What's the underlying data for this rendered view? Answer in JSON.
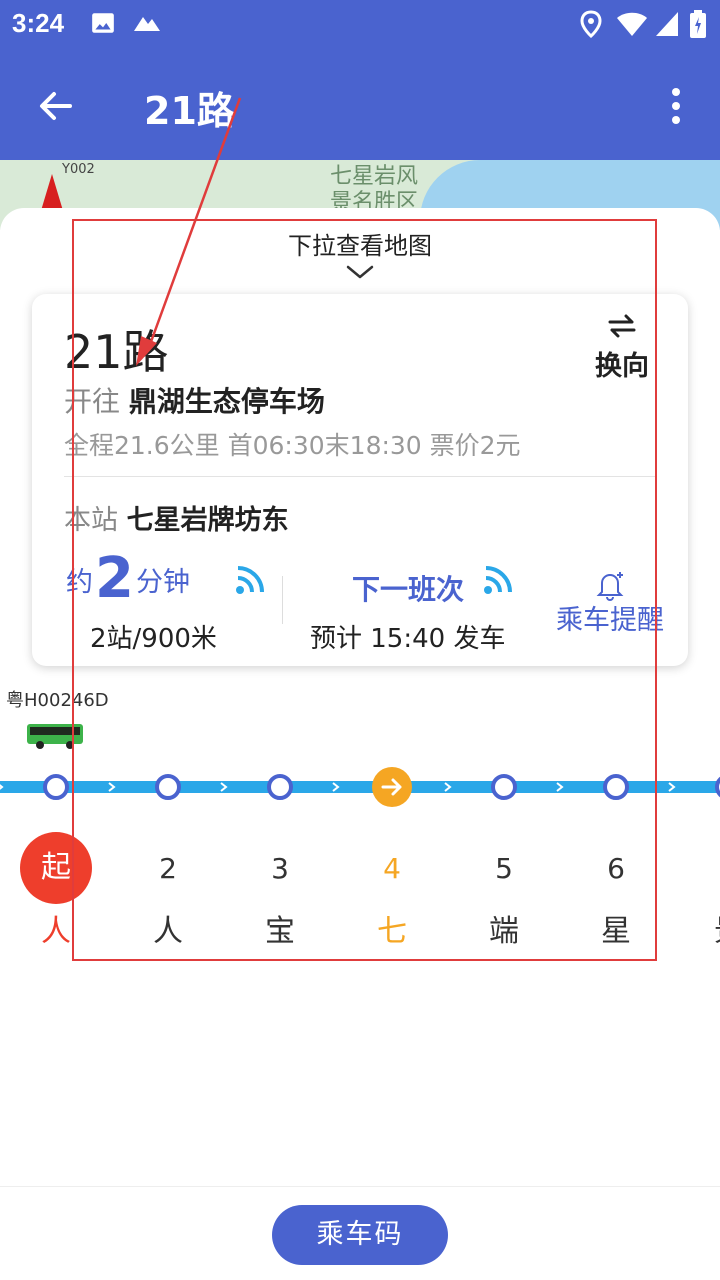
{
  "status_bar": {
    "time": "3:24"
  },
  "app_bar": {
    "title": "21路"
  },
  "map": {
    "road_label": "Y002",
    "scenic_line1": "七星岩风",
    "scenic_line2": "景名胜区"
  },
  "sheet": {
    "pull_hint": "下拉查看地图"
  },
  "route_card": {
    "route_name": "21路",
    "direction_prefix": "开往",
    "destination": "鼎湖生态停车场",
    "meta": "全程21.6公里  首06:30末18:30  票价2元",
    "swap_label": "换向",
    "current_station_prefix": "本站",
    "current_station": "七星岩牌坊东",
    "eta_prefix": "约",
    "eta_value": "2",
    "eta_unit": "分钟",
    "eta_detail": "2站/900米",
    "next_label": "下一班次",
    "next_detail": "预计 15:40 发车",
    "remind_label": "乘车提醒"
  },
  "bus": {
    "plate": "粤H00246D"
  },
  "stops": [
    {
      "num": "起",
      "name": "人"
    },
    {
      "num": "2",
      "name": "人"
    },
    {
      "num": "3",
      "name": "宝"
    },
    {
      "num": "4",
      "name": "七"
    },
    {
      "num": "5",
      "name": "端"
    },
    {
      "num": "6",
      "name": "星"
    },
    {
      "num": "",
      "name": "景"
    }
  ],
  "bottom": {
    "ride_code_label": "乘车码"
  },
  "colors": {
    "primary": "#4a63cf",
    "line": "#2aa7e8",
    "current": "#f5a623",
    "start": "#ee3e2c",
    "annotation": "#e03c3c"
  }
}
